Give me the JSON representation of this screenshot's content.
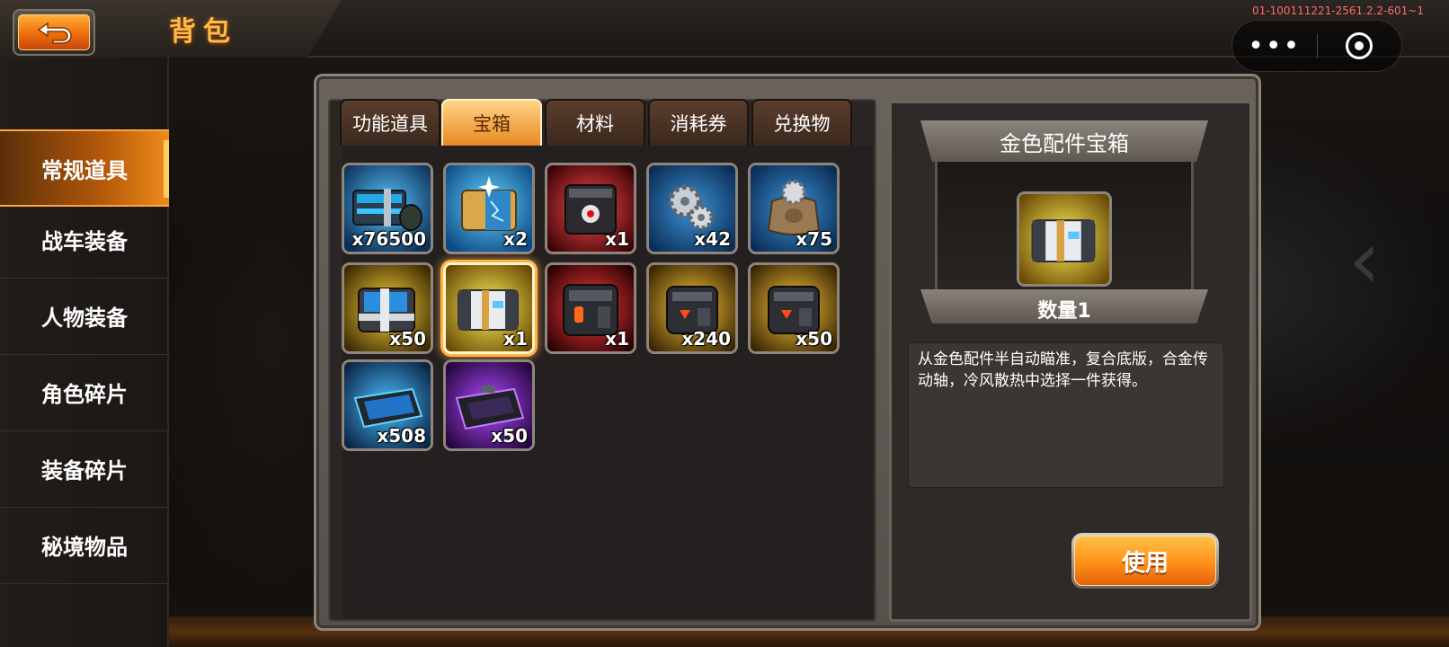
{
  "header": {
    "title": "背包",
    "version": "01-100111221-2561.2.2-601~1",
    "more_label": "•••"
  },
  "sidebar": {
    "items": [
      {
        "label": "常规道具",
        "active": true
      },
      {
        "label": "战车装备",
        "active": false
      },
      {
        "label": "人物装备",
        "active": false
      },
      {
        "label": "角色碎片",
        "active": false
      },
      {
        "label": "装备碎片",
        "active": false
      },
      {
        "label": "秘境物品",
        "active": false
      }
    ]
  },
  "tabs": [
    {
      "label": "功能道具",
      "active": false
    },
    {
      "label": "宝箱",
      "active": true
    },
    {
      "label": "材料",
      "active": false
    },
    {
      "label": "消耗券",
      "active": false
    },
    {
      "label": "兑换物",
      "active": false
    }
  ],
  "items": [
    {
      "qty": "x76500",
      "icon": "blue-ammo-crate-icon",
      "bg": "#1f78b8"
    },
    {
      "qty": "x2",
      "icon": "gold-blue-chest-icon",
      "bg": "#1c8fd0"
    },
    {
      "qty": "x1",
      "icon": "red-robot-cube-icon",
      "bg": "#a2161b"
    },
    {
      "qty": "x42",
      "icon": "gears-icon",
      "bg": "#1d6fb2"
    },
    {
      "qty": "x75",
      "icon": "gear-sack-icon",
      "bg": "#1f6fae"
    },
    {
      "qty": "x50",
      "icon": "gold-blue-crate-icon",
      "bg": "#c58d0a"
    },
    {
      "qty": "x1",
      "icon": "gold-part-chest-icon",
      "bg": "#d1a50c"
    },
    {
      "qty": "x1",
      "icon": "red-black-cube-icon",
      "bg": "#9b1418"
    },
    {
      "qty": "x240",
      "icon": "gold-black-cube-icon",
      "bg": "#c08a0b"
    },
    {
      "qty": "x50",
      "icon": "gold-black-cube-icon",
      "bg": "#c08a0b"
    },
    {
      "qty": "x508",
      "icon": "blue-tray-icon",
      "bg": "#1a6fb0"
    },
    {
      "qty": "x50",
      "icon": "purple-tray-icon",
      "bg": "#6a1ca8"
    }
  ],
  "selected_index": 6,
  "detail": {
    "title": "金色配件宝箱",
    "quantity": "数量1",
    "description": "从金色配件半自动瞄准，复合底版，合金传动轴，冷风散热中选择一件获得。",
    "use_label": "使用",
    "icon": "gold-part-chest-icon"
  },
  "colors": {
    "accent": "#f08a1a",
    "tab_active": "#f2a647",
    "selection": "#ffb347"
  }
}
